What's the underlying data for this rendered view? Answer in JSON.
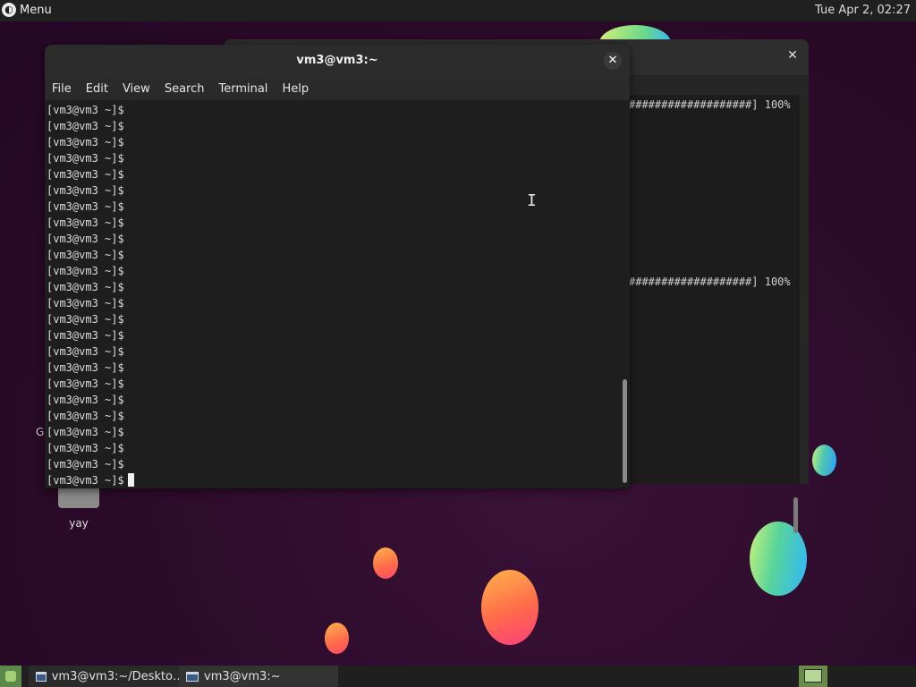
{
  "top_panel": {
    "menu_label": "Menu",
    "clock": "Tue Apr  2, 02:27"
  },
  "back_window": {
    "progress_line_1": "###################] 100%",
    "progress_line_2": "###################] 100%"
  },
  "desktop": {
    "icon_label": "yay",
    "partial_label": "G"
  },
  "terminal": {
    "title": "vm3@vm3:~",
    "menu": [
      "File",
      "Edit",
      "View",
      "Search",
      "Terminal",
      "Help"
    ],
    "prompt": "[vm3@vm3 ~]$",
    "lines": [
      "[vm3@vm3 ~]$",
      "[vm3@vm3 ~]$",
      "[vm3@vm3 ~]$",
      "[vm3@vm3 ~]$",
      "[vm3@vm3 ~]$",
      "[vm3@vm3 ~]$",
      "[vm3@vm3 ~]$",
      "[vm3@vm3 ~]$",
      "[vm3@vm3 ~]$",
      "[vm3@vm3 ~]$",
      "[vm3@vm3 ~]$",
      "[vm3@vm3 ~]$",
      "[vm3@vm3 ~]$",
      "[vm3@vm3 ~]$",
      "[vm3@vm3 ~]$",
      "[vm3@vm3 ~]$",
      "[vm3@vm3 ~]$",
      "[vm3@vm3 ~]$",
      "[vm3@vm3 ~]$",
      "[vm3@vm3 ~]$",
      "[vm3@vm3 ~]$",
      "[vm3@vm3 ~]$",
      "[vm3@vm3 ~]$",
      "[vm3@vm3 ~]$"
    ]
  },
  "taskbar": {
    "tasks": [
      {
        "label": "vm3@vm3:~/Deskto…"
      },
      {
        "label": "vm3@vm3:~"
      }
    ]
  },
  "colors": {
    "desktop_bg": "#2d0c2b",
    "terminal_bg": "#1e1e1e",
    "panel_bg": "#202020"
  }
}
